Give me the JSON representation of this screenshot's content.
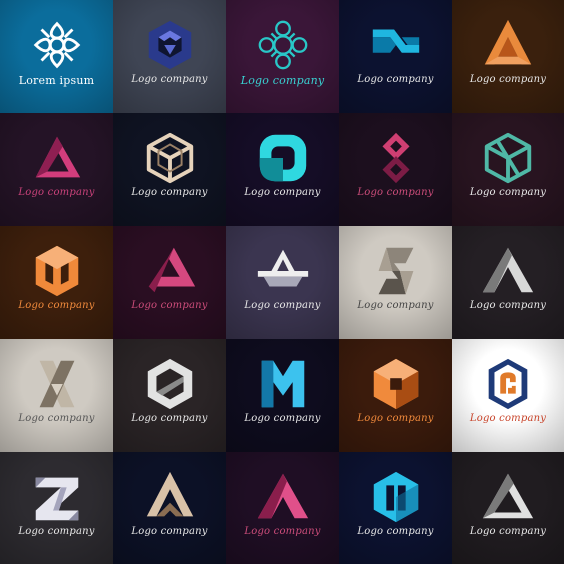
{
  "labels": {
    "lorem": "Lorem ipsum",
    "company": "Logo company",
    "company_script": "Logo company"
  },
  "tiles": [
    {
      "bg": "#0b6d9c",
      "label_color": "#ffffff",
      "icon": "ornament-flower-icon",
      "colors": [
        "#ffffff",
        "#d9eef7"
      ]
    },
    {
      "bg": "#3f4554",
      "label_color": "#e8e8e8",
      "icon": "hexagon-knot-icon",
      "colors": [
        "#2a3a8c",
        "#5a6ad0"
      ]
    },
    {
      "bg": "#3a1638",
      "label_color": "#39d2d2",
      "icon": "ornament-mandala-icon",
      "colors": [
        "#29c7c7",
        "#1e9ea0"
      ]
    },
    {
      "bg": "#0c1230",
      "label_color": "#e8e8e8",
      "icon": "infinity-ribbon-icon",
      "colors": [
        "#1fb6e0",
        "#0a7aa8"
      ]
    },
    {
      "bg": "#3a200d",
      "label_color": "#e8e8e8",
      "icon": "triangle-loop-icon",
      "colors": [
        "#e98a3c",
        "#b8561a"
      ]
    },
    {
      "bg": "#241326",
      "label_color": "#c9427a",
      "icon": "impossible-triangle-icon",
      "colors": [
        "#d23d7c",
        "#8f1f52"
      ]
    },
    {
      "bg": "#0f1322",
      "label_color": "#e8e8e8",
      "icon": "cube-frame-icon",
      "colors": [
        "#e6d3bb",
        "#9a8066"
      ]
    },
    {
      "bg": "#150d26",
      "label_color": "#e8e8e8",
      "icon": "rounded-knot-icon",
      "colors": [
        "#2fd8e0",
        "#118d98"
      ]
    },
    {
      "bg": "#1c0f1e",
      "label_color": "#cc4d7a",
      "icon": "double-diamond-icon",
      "colors": [
        "#cf3f72",
        "#7c1c45"
      ]
    },
    {
      "bg": "#281420",
      "label_color": "#e8e8e8",
      "icon": "cube-cross-icon",
      "colors": [
        "#4fb8a6",
        "#1f6b62"
      ]
    },
    {
      "bg": "#3d1f0c",
      "label_color": "#f08a3c",
      "icon": "hexagon-m-icon",
      "colors": [
        "#f0893a",
        "#a44e12"
      ]
    },
    {
      "bg": "#2a0e22",
      "label_color": "#cc4d7a",
      "icon": "triangle-twist-icon",
      "colors": [
        "#d5487f",
        "#8a1e4c"
      ]
    },
    {
      "bg": "#3b3550",
      "label_color": "#e8e8e8",
      "icon": "triangle-arrow-icon",
      "colors": [
        "#eeeeee",
        "#a8a8b8"
      ]
    },
    {
      "bg": "#cfcac2",
      "label_color": "#444444",
      "icon": "s-knot-icon",
      "colors": [
        "#8d857a",
        "#5a544c"
      ]
    },
    {
      "bg": "#241f24",
      "label_color": "#e8e8e8",
      "icon": "triangle-fold-icon",
      "colors": [
        "#d8d8d8",
        "#7a7a7a"
      ]
    },
    {
      "bg": "#cfcac2",
      "label_color": "#555555",
      "icon": "x-ribbon-icon",
      "colors": [
        "#c0b6a6",
        "#7d7263"
      ]
    },
    {
      "bg": "#2a2426",
      "label_color": "#e8e8e8",
      "icon": "hexagon-ring-icon",
      "colors": [
        "#e2e2e2",
        "#8a8a8a"
      ]
    },
    {
      "bg": "#0e0c1e",
      "label_color": "#e8e8e8",
      "icon": "m-ribbon-icon",
      "colors": [
        "#3cc2ee",
        "#1378a8"
      ]
    },
    {
      "bg": "#3b1b0c",
      "label_color": "#f08a3c",
      "icon": "cube-hexagon-icon",
      "colors": [
        "#f08a3c",
        "#a94d13"
      ]
    },
    {
      "bg": "#ffffff",
      "label_color": "#c8442a",
      "icon": "hexagon-outline-icon",
      "colors": [
        "#e07a2a",
        "#1e3a78"
      ]
    },
    {
      "bg": "#2d2b30",
      "label_color": "#e8e8e8",
      "icon": "z-knot-icon",
      "colors": [
        "#e6e6ef",
        "#8888a0"
      ]
    },
    {
      "bg": "#0c1126",
      "label_color": "#e8e8e8",
      "icon": "a-loop-icon",
      "colors": [
        "#d9c2a8",
        "#8a6d52"
      ]
    },
    {
      "bg": "#1f0e24",
      "label_color": "#cc4d7a",
      "icon": "triangle-peak-icon",
      "colors": [
        "#e0508a",
        "#8a1e4c"
      ]
    },
    {
      "bg": "#0c1230",
      "label_color": "#e8e8e8",
      "icon": "hexagon-cup-icon",
      "colors": [
        "#28bfe8",
        "#0e6f9c"
      ]
    },
    {
      "bg": "#201c20",
      "label_color": "#e8e8e8",
      "icon": "penrose-triangle-icon",
      "colors": [
        "#e0e0e0",
        "#7a7a7a"
      ]
    }
  ]
}
